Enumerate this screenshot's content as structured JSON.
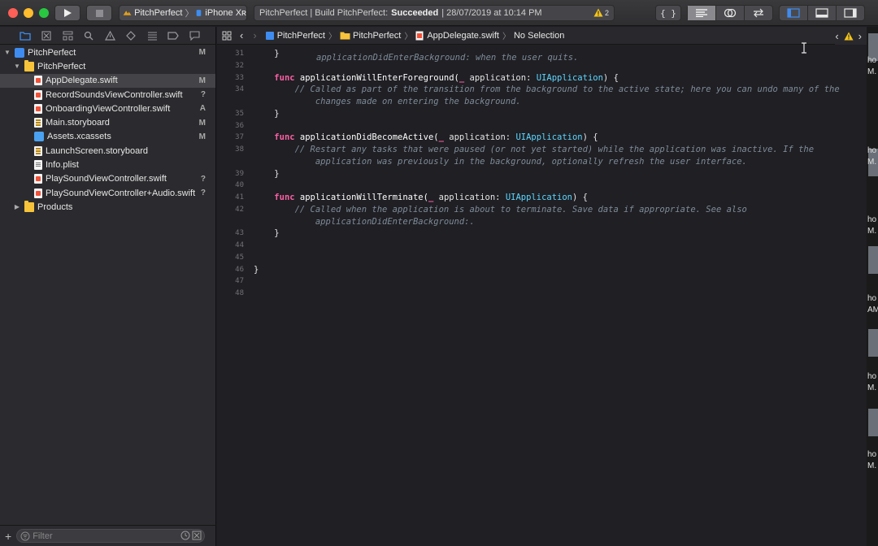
{
  "toolbar": {
    "scheme_target": "PitchPerfect",
    "scheme_device": "iPhone Xʀ",
    "activity_prefix": "PitchPerfect | Build PitchPerfect:",
    "activity_status": "Succeeded",
    "activity_time": "| 28/07/2019 at 10:14 PM",
    "warning_count": "2",
    "editor_buttons": [
      "standard-editor",
      "assistant-editor",
      "version-editor"
    ],
    "panel_buttons": [
      "navigator-panel",
      "debug-panel",
      "utilities-panel"
    ]
  },
  "navigator": {
    "tabs": [
      "project",
      "source-control",
      "symbol",
      "find",
      "issue",
      "test",
      "debug",
      "breakpoint",
      "report"
    ],
    "items": [
      {
        "label": "PitchPerfect",
        "status": "M",
        "level": 0,
        "icon": "proj-icon",
        "disclosure": "▼"
      },
      {
        "label": "PitchPerfect",
        "status": "",
        "level": 1,
        "icon": "folder-icon",
        "disclosure": "▼"
      },
      {
        "label": "AppDelegate.swift",
        "status": "M",
        "level": 2,
        "icon": "file-icon",
        "disclosure": ""
      },
      {
        "label": "RecordSoundsViewController.swift",
        "status": "?",
        "level": 2,
        "icon": "file-icon",
        "disclosure": ""
      },
      {
        "label": "OnboardingViewController.swift",
        "status": "A",
        "level": 2,
        "icon": "file-icon",
        "disclosure": ""
      },
      {
        "label": "Main.storyboard",
        "status": "M",
        "level": 2,
        "icon": "sb-icon",
        "disclosure": ""
      },
      {
        "label": "Assets.xcassets",
        "status": "M",
        "level": 2,
        "icon": "assets-icon",
        "disclosure": ""
      },
      {
        "label": "LaunchScreen.storyboard",
        "status": "",
        "level": 2,
        "icon": "sb-icon",
        "disclosure": ""
      },
      {
        "label": "Info.plist",
        "status": "",
        "level": 2,
        "icon": "plist-icon",
        "disclosure": ""
      },
      {
        "label": "PlaySoundViewController.swift",
        "status": "?",
        "level": 2,
        "icon": "file-icon",
        "disclosure": ""
      },
      {
        "label": "PlaySoundViewController+Audio.swift",
        "status": "?",
        "level": 2,
        "icon": "file-icon",
        "disclosure": ""
      },
      {
        "label": "Products",
        "status": "",
        "level": 1,
        "icon": "folder-icon",
        "disclosure": "▶"
      }
    ],
    "selected_index": 2,
    "filter_placeholder": "Filter"
  },
  "jumpbar": {
    "path": [
      "PitchPerfect",
      "PitchPerfect",
      "AppDelegate.swift",
      "No Selection"
    ]
  },
  "code": {
    "top_partial_comment": "applicationDidEnterBackground: when the user quits.",
    "lines": [
      {
        "n": "31",
        "segs": [
          {
            "t": "    }",
            "c": ""
          }
        ]
      },
      {
        "n": "32",
        "segs": []
      },
      {
        "n": "33",
        "segs": [
          {
            "t": "    ",
            "c": ""
          },
          {
            "t": "func",
            "c": "kw"
          },
          {
            "t": " applicationWillEnterForeground(",
            "c": "fn"
          },
          {
            "t": "_",
            "c": "kw"
          },
          {
            "t": " application: ",
            "c": ""
          },
          {
            "t": "UIApplication",
            "c": "ty"
          },
          {
            "t": ") {",
            "c": ""
          }
        ]
      },
      {
        "n": "34",
        "segs": [
          {
            "t": "        // Called as part of the transition from the background to the active state; here you can undo many of the",
            "c": "cm"
          }
        ]
      },
      {
        "n": "",
        "segs": [
          {
            "t": "            changes made on entering the background.",
            "c": "cm"
          }
        ]
      },
      {
        "n": "35",
        "segs": [
          {
            "t": "    }",
            "c": ""
          }
        ]
      },
      {
        "n": "36",
        "segs": []
      },
      {
        "n": "37",
        "segs": [
          {
            "t": "    ",
            "c": ""
          },
          {
            "t": "func",
            "c": "kw"
          },
          {
            "t": " applicationDidBecomeActive(",
            "c": "fn"
          },
          {
            "t": "_",
            "c": "kw"
          },
          {
            "t": " application: ",
            "c": ""
          },
          {
            "t": "UIApplication",
            "c": "ty"
          },
          {
            "t": ") {",
            "c": ""
          }
        ]
      },
      {
        "n": "38",
        "segs": [
          {
            "t": "        // Restart any tasks that were paused (or not yet started) while the application was inactive. If the",
            "c": "cm"
          }
        ]
      },
      {
        "n": "",
        "segs": [
          {
            "t": "            application was previously in the background, optionally refresh the user interface.",
            "c": "cm"
          }
        ]
      },
      {
        "n": "39",
        "segs": [
          {
            "t": "    }",
            "c": ""
          }
        ]
      },
      {
        "n": "40",
        "segs": []
      },
      {
        "n": "41",
        "segs": [
          {
            "t": "    ",
            "c": ""
          },
          {
            "t": "func",
            "c": "kw"
          },
          {
            "t": " applicationWillTerminate(",
            "c": "fn"
          },
          {
            "t": "_",
            "c": "kw"
          },
          {
            "t": " application: ",
            "c": ""
          },
          {
            "t": "UIApplication",
            "c": "ty"
          },
          {
            "t": ") {",
            "c": ""
          }
        ]
      },
      {
        "n": "42",
        "segs": [
          {
            "t": "        // Called when the application is about to terminate. Save data if appropriate. See also",
            "c": "cm"
          }
        ]
      },
      {
        "n": "",
        "segs": [
          {
            "t": "            applicationDidEnterBackground:.",
            "c": "cm"
          }
        ]
      },
      {
        "n": "43",
        "segs": [
          {
            "t": "    }",
            "c": ""
          }
        ]
      },
      {
        "n": "44",
        "segs": []
      },
      {
        "n": "45",
        "segs": []
      },
      {
        "n": "46",
        "segs": [
          {
            "t": "}",
            "c": ""
          }
        ]
      },
      {
        "n": "47",
        "segs": []
      },
      {
        "n": "48",
        "segs": []
      }
    ]
  },
  "desktop": {
    "labels": [
      "ho",
      "M.",
      "ho",
      "M.",
      "ho",
      "M.",
      "ho",
      "AM",
      "ho",
      "M.",
      "ho",
      "M."
    ]
  },
  "colors": {
    "keyword": "#fc5fa3",
    "type": "#5dd8ff",
    "comment": "#7f8c98",
    "warning": "#f5c518",
    "accent": "#3f8cf0"
  }
}
